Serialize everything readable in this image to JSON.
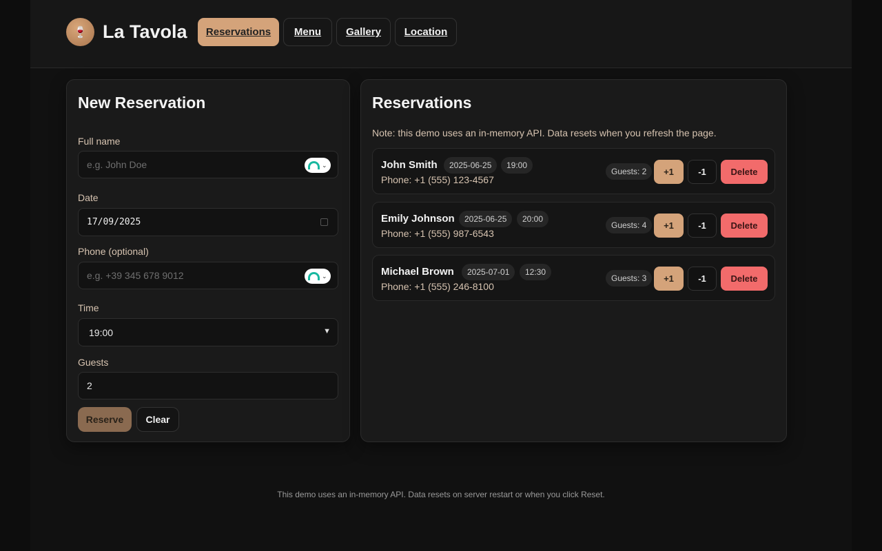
{
  "header": {
    "logo_glyph": "🍷",
    "brand": "La Tavola",
    "nav": [
      {
        "label": "Reservations",
        "active": true
      },
      {
        "label": "Menu",
        "active": false
      },
      {
        "label": "Gallery",
        "active": false
      },
      {
        "label": "Location",
        "active": false
      }
    ]
  },
  "form": {
    "title": "New Reservation",
    "full_name": {
      "label": "Full name",
      "placeholder": "e.g. John Doe"
    },
    "date": {
      "label": "Date",
      "value": "17/09/2025"
    },
    "phone": {
      "label": "Phone (optional)",
      "placeholder": "e.g. +39 345 678 9012"
    },
    "time": {
      "label": "Time",
      "value": "19:00"
    },
    "guests": {
      "label": "Guests",
      "value": "2"
    },
    "reserve_label": "Reserve",
    "clear_label": "Clear"
  },
  "list": {
    "title": "Reservations",
    "note": "Note: this demo uses an in-memory API. Data resets when you refresh the page.",
    "plus_label": "+1",
    "minus_label": "-1",
    "delete_label": "Delete",
    "items": [
      {
        "name": "John Smith",
        "date": "2025-06-25",
        "time": "19:00",
        "phone": "Phone: +1 (555) 123-4567",
        "guests": "Guests: 2"
      },
      {
        "name": "Emily Johnson",
        "date": "2025-06-25",
        "time": "20:00",
        "phone": "Phone: +1 (555) 987-6543",
        "guests": "Guests: 4"
      },
      {
        "name": "Michael Brown",
        "date": "2025-07-01",
        "time": "12:30",
        "phone": "Phone: +1 (555) 246-8100",
        "guests": "Guests: 3"
      }
    ]
  },
  "footer": {
    "text": "This demo uses an in-memory API. Data resets on server restart or when you click Reset."
  },
  "colors": {
    "accent": "#d4a37a",
    "danger": "#f26b6b",
    "background": "#111111"
  }
}
